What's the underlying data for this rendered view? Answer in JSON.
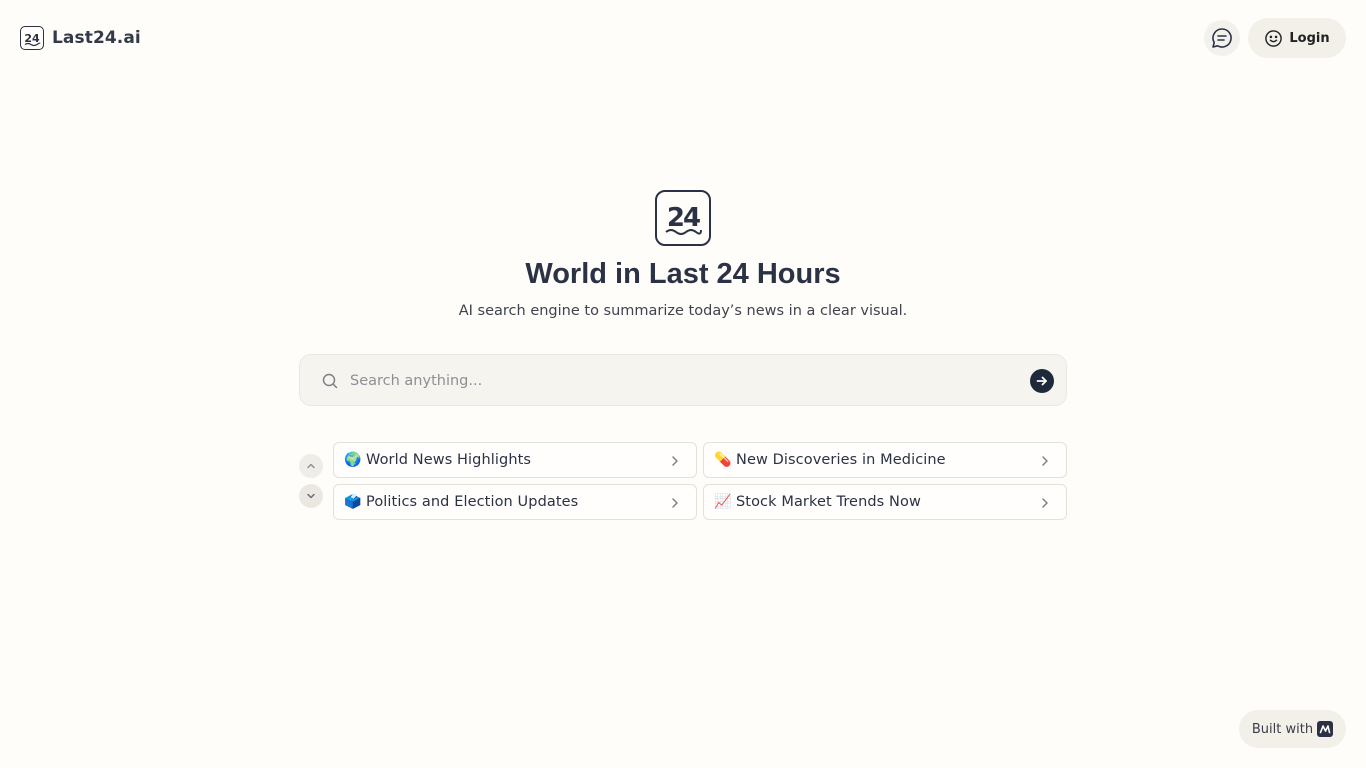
{
  "header": {
    "brand_name": "Last24.ai",
    "brand_logo_text": "24",
    "login_label": "Login",
    "icons": {
      "brand": "brand-logo-icon",
      "chat": "chat-icon",
      "login": "smile-icon"
    }
  },
  "hero": {
    "logo_text": "24",
    "title": "World in Last 24 Hours",
    "subtitle": "AI search engine to summarize today’s news in a clear visual."
  },
  "search": {
    "placeholder": "Search anything...",
    "value": "",
    "icons": {
      "search": "search-icon",
      "submit": "arrow-right-icon"
    }
  },
  "suggestions": {
    "items": [
      {
        "emoji": "🌍",
        "label": "World News Highlights"
      },
      {
        "emoji": "💊",
        "label": "New Discoveries in Medicine"
      },
      {
        "emoji": "🗳️",
        "label": "Politics and Election Updates"
      },
      {
        "emoji": "📈",
        "label": "Stock Market Trends Now"
      }
    ],
    "icons": {
      "up": "chevron-up-icon",
      "down": "chevron-down-icon",
      "item": "chevron-right-icon"
    }
  },
  "footer": {
    "built_with_label": "Built with"
  },
  "colors": {
    "background": "#fefdfa",
    "accent": "#1e293b",
    "title": "#2b3245"
  }
}
